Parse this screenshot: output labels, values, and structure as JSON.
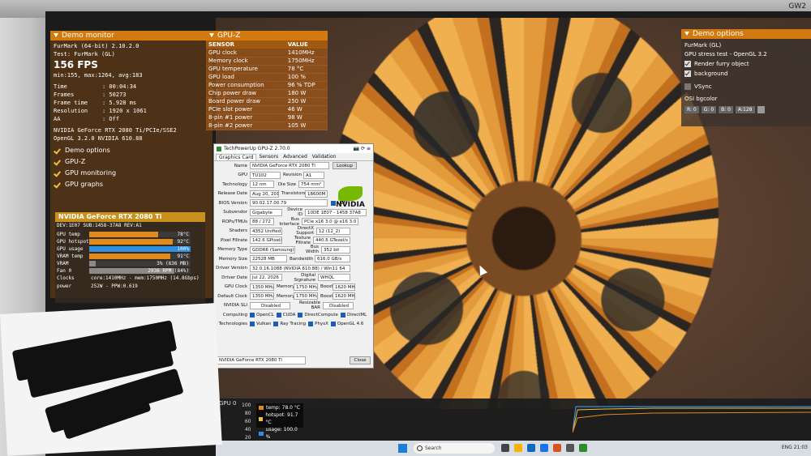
{
  "monitor_brand": "GW2",
  "demo_monitor": {
    "panel_title": "Demo monitor",
    "app_line": "FurMark (64-bit) 2.10.2.0",
    "test_line": "Test: FurMark (GL)",
    "fps": "156 FPS",
    "fps_stats": "min:155, max:1264, avg:183",
    "stats": [
      {
        "k": "Time",
        "v": ": 00:04:34"
      },
      {
        "k": "Frames",
        "v": ": 50273"
      },
      {
        "k": "Frame time",
        "v": ": 5.928 ms"
      },
      {
        "k": "Resolution",
        "v": ": 1920 x 1061"
      },
      {
        "k": "AA",
        "v": ": Off"
      }
    ],
    "gpu_line": "NVIDIA GeForce RTX 2080 Ti/PCIe/SSE2",
    "gl_line": "OpenGL 3.2.0 NVIDIA 610.88",
    "options": [
      "Demo options",
      "GPU-Z",
      "GPU monitoring",
      "GPU graphs"
    ]
  },
  "gpu_monitor": {
    "title": "NVIDIA GeForce RTX 2080 Ti",
    "pci": "DEV:1E07 SUB:1458-37A8 REV:A1",
    "bars": [
      {
        "label": "GPU temp",
        "value": "78°C",
        "pct": 0.68,
        "color": "#e08a1e"
      },
      {
        "label": "GPU hotspot",
        "value": "92°C",
        "pct": 0.82,
        "color": "#e08a1e"
      },
      {
        "label": "GPU usage",
        "value": "100%",
        "pct": 1.0,
        "color": "#2f8fe0"
      },
      {
        "label": "VRAM temp",
        "value": "91°C",
        "pct": 0.8,
        "color": "#e08a1e"
      },
      {
        "label": "VRAM",
        "value": "3% (636 MB)",
        "pct": 0.06,
        "color": "#8a8a8a"
      },
      {
        "label": "Fan 0",
        "value": "2936 RPM (84%)",
        "pct": 0.84,
        "color": "#8a8a8a"
      }
    ],
    "clocks_label": "Clocks",
    "clocks_value": "core:1410MHz - mem:1750MHz (14.8Gbps)",
    "power_label": "power",
    "power_value": "252W - PPW:0.619"
  },
  "gpuz_panel": {
    "title": "GPU-Z",
    "col_sensor": "SENSOR",
    "col_value": "VALUE",
    "rows": [
      {
        "s": "GPU clock",
        "v": "1410MHz"
      },
      {
        "s": "Memory clock",
        "v": "1750MHz"
      },
      {
        "s": "GPU temperature",
        "v": "78 °C"
      },
      {
        "s": "GPU load",
        "v": "100 %"
      },
      {
        "s": "Power consumption",
        "v": "96 % TDP"
      },
      {
        "s": "Chip power draw",
        "v": "180 W"
      },
      {
        "s": "Board power draw",
        "v": "250 W"
      },
      {
        "s": "PCIe slot power",
        "v": "46 W"
      },
      {
        "s": "8-pin #1 power",
        "v": "98 W"
      },
      {
        "s": "8-pin #2 power",
        "v": "105 W"
      }
    ]
  },
  "gpuz_window": {
    "title": "TechPowerUp GPU-Z 2.70.0",
    "tabs": [
      "Graphics Card",
      "Sensors",
      "Advanced",
      "Validation"
    ],
    "name_label": "Name",
    "name": "NVIDIA GeForce RTX 2080 Ti",
    "lookup": "Lookup",
    "gpu_label": "GPU",
    "gpu": "TU102",
    "revision_label": "Revision",
    "revision": "A1",
    "tech_label": "Technology",
    "tech": "12 nm",
    "die_label": "Die Size",
    "die": "754 mm²",
    "release_label": "Release Date",
    "release": "Aug 20, 2018",
    "trans_label": "Transistors",
    "trans": "18600M",
    "bios_label": "BIOS Version",
    "bios": "90.02.17.00.79",
    "uefi": "UEFI",
    "subvendor_label": "Subvendor",
    "subvendor": "Gigabyte",
    "devid_label": "Device ID",
    "devid": "10DE 1E07 - 1458 37A8",
    "rops_label": "ROPs/TMUs",
    "rops": "88 / 272",
    "bus_label": "Bus Interface",
    "bus": "PCIe x16 3.0 @ x16 3.0",
    "shaders_label": "Shaders",
    "shaders": "4352 Unified",
    "dx_label": "DirectX Support",
    "dx": "12 (12_2)",
    "pixel_label": "Pixel Fillrate",
    "pixel": "142.6 GPixel/s",
    "tex_label": "Texture Fillrate",
    "tex": "440.6 GTexel/s",
    "memtype_label": "Memory Type",
    "memtype": "GDDR6 (Samsung)",
    "buswidth_label": "Bus Width",
    "buswidth": "352 bit",
    "memsize_label": "Memory Size",
    "memsize": "22528 MB",
    "bandwidth_label": "Bandwidth",
    "bandwidth": "616.0 GB/s",
    "driver_label": "Driver Version",
    "driver": "32.0.16.1088 (NVIDIA 610.88) / Win11 64",
    "ddate_label": "Driver Date",
    "ddate": "Jul 22, 2026",
    "sig_label": "Digital Signature",
    "sig": "WHQL",
    "gpuclk_label": "GPU Clock",
    "gpuclk": "1350 MHz",
    "mem_label": "Memory",
    "memclk": "1750 MHz",
    "boost_label": "Boost",
    "boost": "1620 MHz",
    "defclk_label": "Default Clock",
    "defclk": "1350 MHz",
    "defmem": "1750 MHz",
    "defboost": "1620 MHz",
    "sli_label": "NVIDIA SLI",
    "sli": "Disabled",
    "rebar_label": "Resizable BAR",
    "rebar": "Disabled",
    "computing_label": "Computing",
    "computing": [
      "OpenCL",
      "CUDA",
      "DirectCompute",
      "DirectML"
    ],
    "tech2_label": "Technologies",
    "technologies": [
      "Vulkan",
      "Ray Tracing",
      "PhysX",
      "OpenGL 4.6"
    ],
    "select": "NVIDIA GeForce RTX 2080 Ti",
    "close": "Close",
    "nvidia": "NVIDIA"
  },
  "demo_options": {
    "title": "Demo options",
    "line1": "FurMark (GL)",
    "line2": "GPU stress test - OpenGL 3.2",
    "render_furry": "Render furry object",
    "background": "background",
    "vsync": "VSync",
    "osi_label": "OSI bgcolor",
    "bg": [
      "R: 0",
      "G: 0",
      "B: 0",
      "A:128"
    ]
  },
  "graph": {
    "label": "GPU 0",
    "axis": [
      "100",
      "80",
      "60",
      "40",
      "20"
    ],
    "legend": [
      {
        "text": "temp: 78.0 °C",
        "color": "#e08a1e"
      },
      {
        "text": "hotspot: 91.7 °C",
        "color": "#f0c040"
      },
      {
        "text": "usage: 100.0 %",
        "color": "#2f8fe0"
      }
    ]
  },
  "taskbar": {
    "search": "Search",
    "tray": "ENG  21:03"
  }
}
